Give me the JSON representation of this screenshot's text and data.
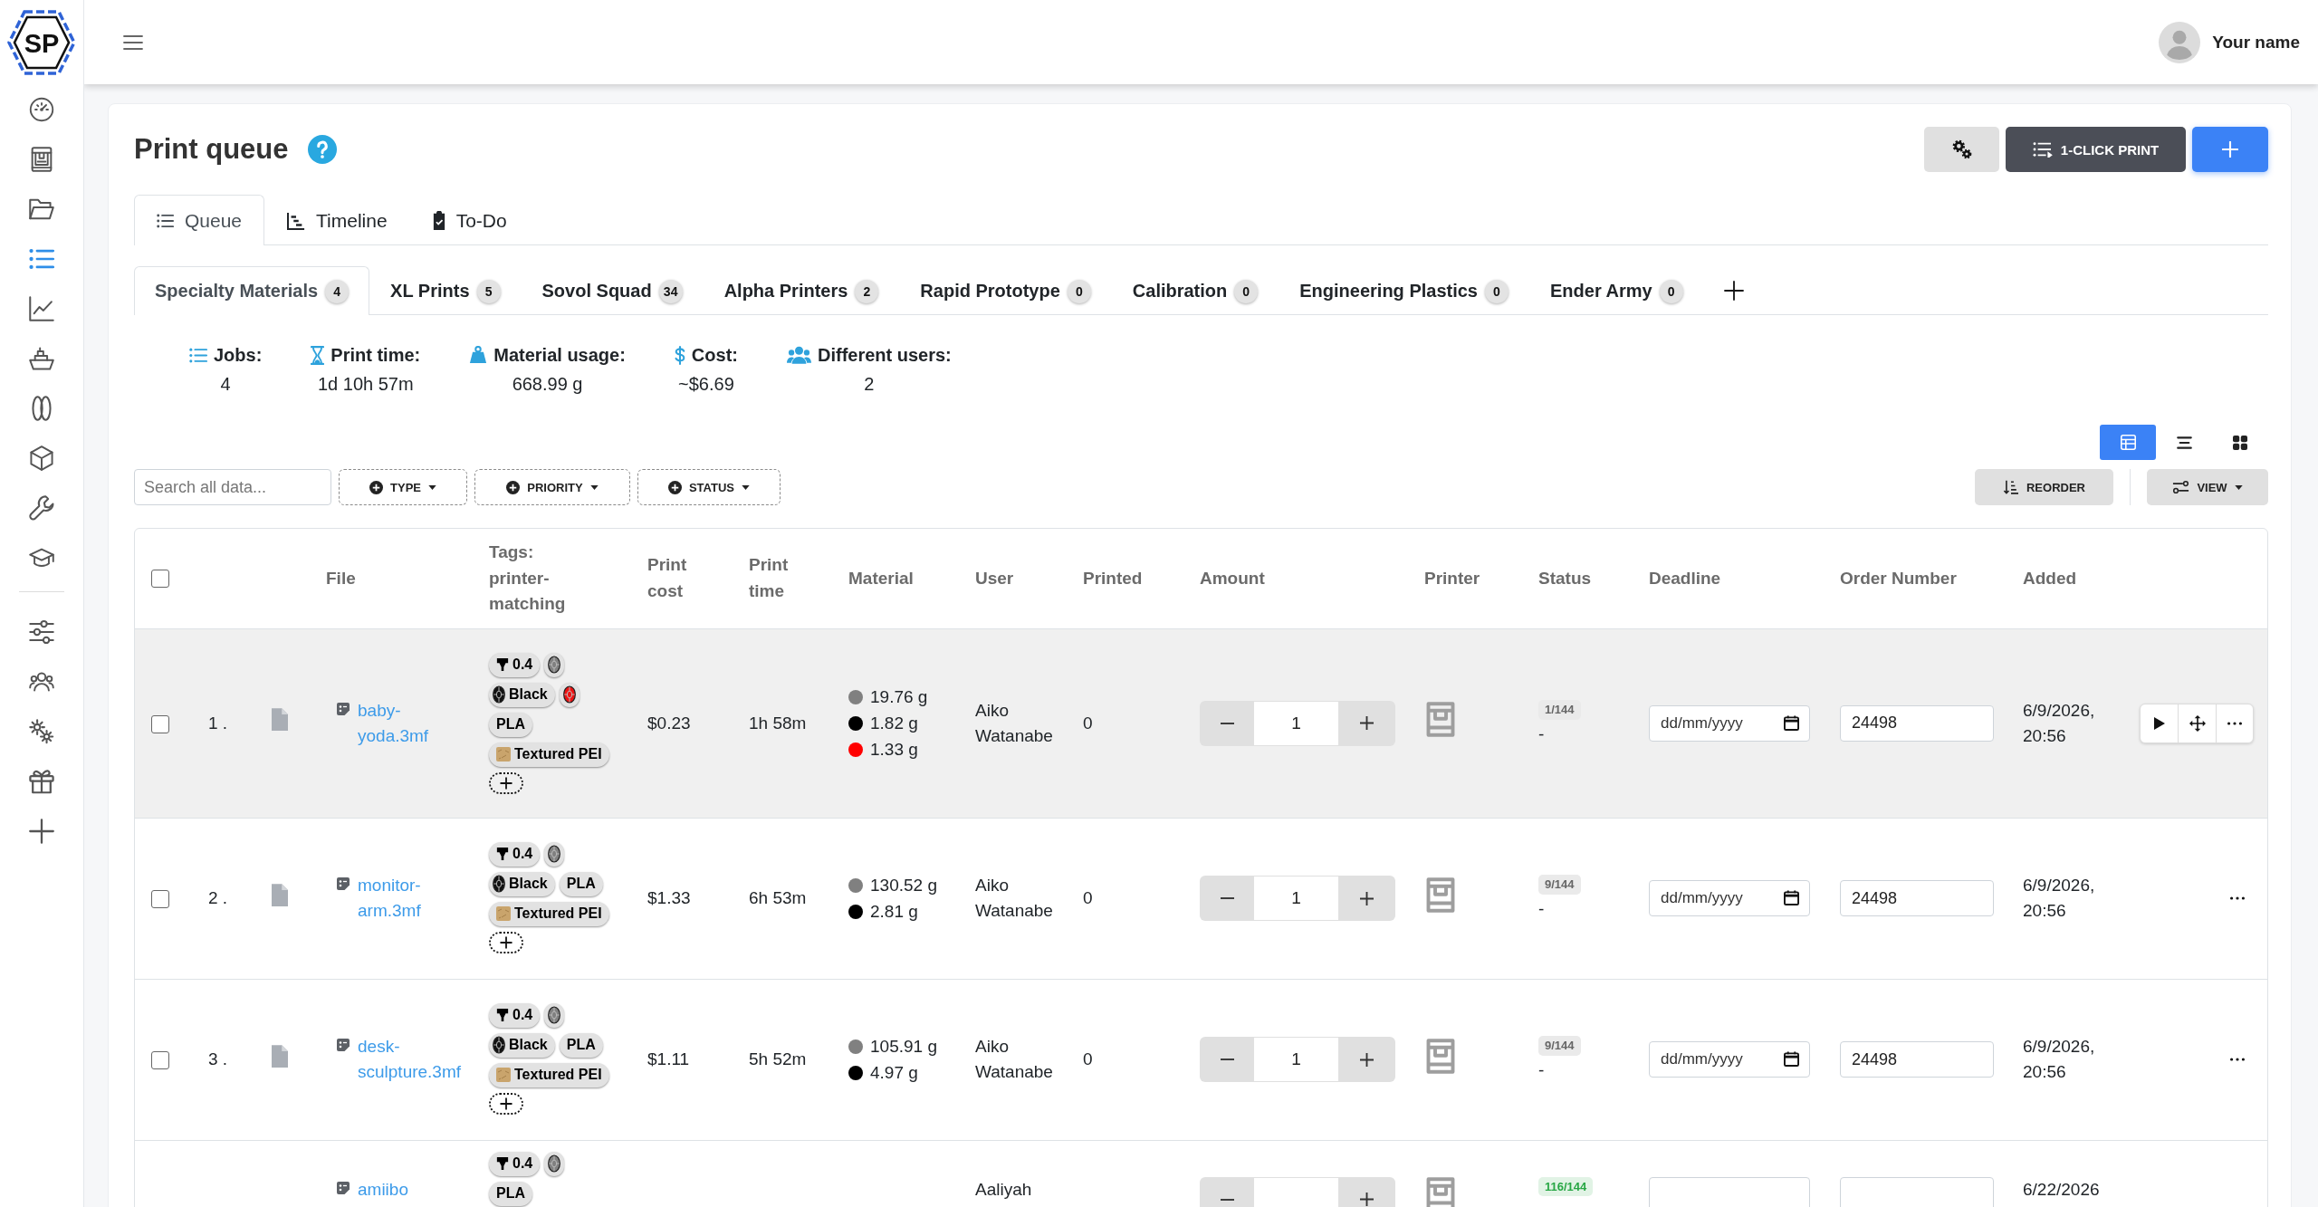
{
  "logo": {
    "text": "SP"
  },
  "sidebar": {
    "main_items": [
      {
        "selected": false
      },
      {
        "selected": false
      },
      {
        "selected": false
      },
      {
        "selected": true
      },
      {
        "selected": false
      },
      {
        "selected": false
      },
      {
        "selected": false
      },
      {
        "selected": false
      },
      {
        "selected": false
      },
      {
        "selected": false
      }
    ],
    "bottom_items": [
      {
        "selected": false
      },
      {
        "selected": false
      },
      {
        "selected": false
      },
      {
        "selected": false
      },
      {
        "selected": false
      }
    ]
  },
  "header": {
    "user_name": "Your name"
  },
  "page": {
    "title": "Print queue",
    "toolbar": [
      {
        "kind": "settings"
      },
      {
        "kind": "one_click",
        "label": "1-CLICK PRINT"
      },
      {
        "kind": "add"
      }
    ]
  },
  "view_tabs": [
    {
      "label": "Queue",
      "selected": true
    },
    {
      "label": "Timeline",
      "selected": false
    },
    {
      "label": "To-Do",
      "selected": false
    }
  ],
  "queue_tabs": [
    {
      "label": "Specialty Materials",
      "count": "4",
      "selected": true
    },
    {
      "label": "XL Prints",
      "count": "5",
      "selected": false
    },
    {
      "label": "Sovol Squad",
      "count": "34",
      "selected": false
    },
    {
      "label": "Alpha Printers",
      "count": "2",
      "selected": false
    },
    {
      "label": "Rapid Prototype",
      "count": "0",
      "selected": false
    },
    {
      "label": "Calibration",
      "count": "0",
      "selected": false
    },
    {
      "label": "Engineering Plastics",
      "count": "0",
      "selected": false
    },
    {
      "label": "Ender Army",
      "count": "0",
      "selected": false
    }
  ],
  "stats": [
    {
      "label": "Jobs:",
      "value": "4"
    },
    {
      "label": "Print time:",
      "value": "1d 10h 57m"
    },
    {
      "label": "Material usage:",
      "value": "668.99 g"
    },
    {
      "label": "Cost:",
      "value": "~$6.69"
    },
    {
      "label": "Different users:",
      "value": "2"
    }
  ],
  "layout_options": [
    {
      "selected": true
    },
    {
      "selected": false
    },
    {
      "selected": false
    }
  ],
  "filters": {
    "search": {
      "placeholder": "Search all data..."
    },
    "buttons": [
      {
        "label": "TYPE"
      },
      {
        "label": "PRIORITY"
      },
      {
        "label": "STATUS"
      }
    ]
  },
  "table_actions": [
    {
      "label": "REORDER"
    },
    {
      "label": "VIEW"
    }
  ],
  "table": {
    "select_all": {
      "checked": false
    },
    "columns": [
      "File",
      "Tags: printer-matching",
      "Print cost",
      "Print time",
      "Material",
      "User",
      "Printed",
      "Amount",
      "Printer",
      "Status",
      "Deadline",
      "Order Number",
      "Added"
    ],
    "rows": [
      {
        "checked": false,
        "hovered": true,
        "index": "1 .",
        "file": "baby-yoda.3mf",
        "tags": [
          {
            "kind": "nozzle",
            "label": "0.4"
          },
          {
            "kind": "filament",
            "color": "#808080"
          },
          {
            "kind": "filament",
            "color": "#111111",
            "label": "Black"
          },
          {
            "kind": "filament",
            "color": "#ee1111"
          },
          {
            "kind": "material",
            "label": "PLA"
          },
          {
            "kind": "plate",
            "label": "Textured PEI"
          },
          {
            "kind": "add"
          }
        ],
        "print_cost": "$0.23",
        "print_time": "1h 58m",
        "material": [
          {
            "color": "#808080",
            "amount": "19.76 g"
          },
          {
            "color": "#000000",
            "amount": "1.82 g"
          },
          {
            "color": "#ff0000",
            "amount": "1.33 g"
          }
        ],
        "user": "Aiko Watanabe",
        "printed": "0",
        "amount": "1",
        "status": {
          "label": "1/144",
          "color": "#666666"
        },
        "status_detail": "-",
        "deadline": {
          "placeholder": "dd/mm/yyyy"
        },
        "order_number": "24498",
        "added": "6/9/2026, 20:56"
      },
      {
        "checked": false,
        "hovered": false,
        "index": "2 .",
        "file": "monitor-arm.3mf",
        "tags": [
          {
            "kind": "nozzle",
            "label": "0.4"
          },
          {
            "kind": "filament",
            "color": "#808080"
          },
          {
            "kind": "filament",
            "color": "#111111",
            "label": "Black"
          },
          {
            "kind": "material",
            "label": "PLA"
          },
          {
            "kind": "plate",
            "label": "Textured PEI"
          },
          {
            "kind": "add"
          }
        ],
        "print_cost": "$1.33",
        "print_time": "6h 53m",
        "material": [
          {
            "color": "#808080",
            "amount": "130.52 g"
          },
          {
            "color": "#000000",
            "amount": "2.81 g"
          }
        ],
        "user": "Aiko Watanabe",
        "printed": "0",
        "amount": "1",
        "status": {
          "label": "9/144",
          "color": "#666666"
        },
        "status_detail": "-",
        "deadline": {
          "placeholder": "dd/mm/yyyy"
        },
        "order_number": "24498",
        "added": "6/9/2026, 20:56"
      },
      {
        "checked": false,
        "hovered": false,
        "index": "3 .",
        "file": "desk-sculpture.3mf",
        "tags": [
          {
            "kind": "nozzle",
            "label": "0.4"
          },
          {
            "kind": "filament",
            "color": "#808080"
          },
          {
            "kind": "filament",
            "color": "#111111",
            "label": "Black"
          },
          {
            "kind": "material",
            "label": "PLA"
          },
          {
            "kind": "plate",
            "label": "Textured PEI"
          },
          {
            "kind": "add"
          }
        ],
        "print_cost": "$1.11",
        "print_time": "5h 52m",
        "material": [
          {
            "color": "#808080",
            "amount": "105.91 g"
          },
          {
            "color": "#000000",
            "amount": "4.97 g"
          }
        ],
        "user": "Aiko Watanabe",
        "printed": "0",
        "amount": "1",
        "status": {
          "label": "9/144",
          "color": "#666666"
        },
        "status_detail": "-",
        "deadline": {
          "placeholder": "dd/mm/yyyy"
        },
        "order_number": "24498",
        "added": "6/9/2026, 20:56"
      },
      {
        "hovered": false,
        "file": "amiibo",
        "tags": [
          {
            "kind": "nozzle",
            "label": "0.4"
          },
          {
            "kind": "filament",
            "color": "#808080"
          },
          {
            "kind": "material",
            "label": "PLA"
          }
        ],
        "user": "Aaliyah",
        "status": {
          "label": "116/144",
          "color": "#28a745"
        },
        "added": "6/22/2026"
      }
    ]
  }
}
